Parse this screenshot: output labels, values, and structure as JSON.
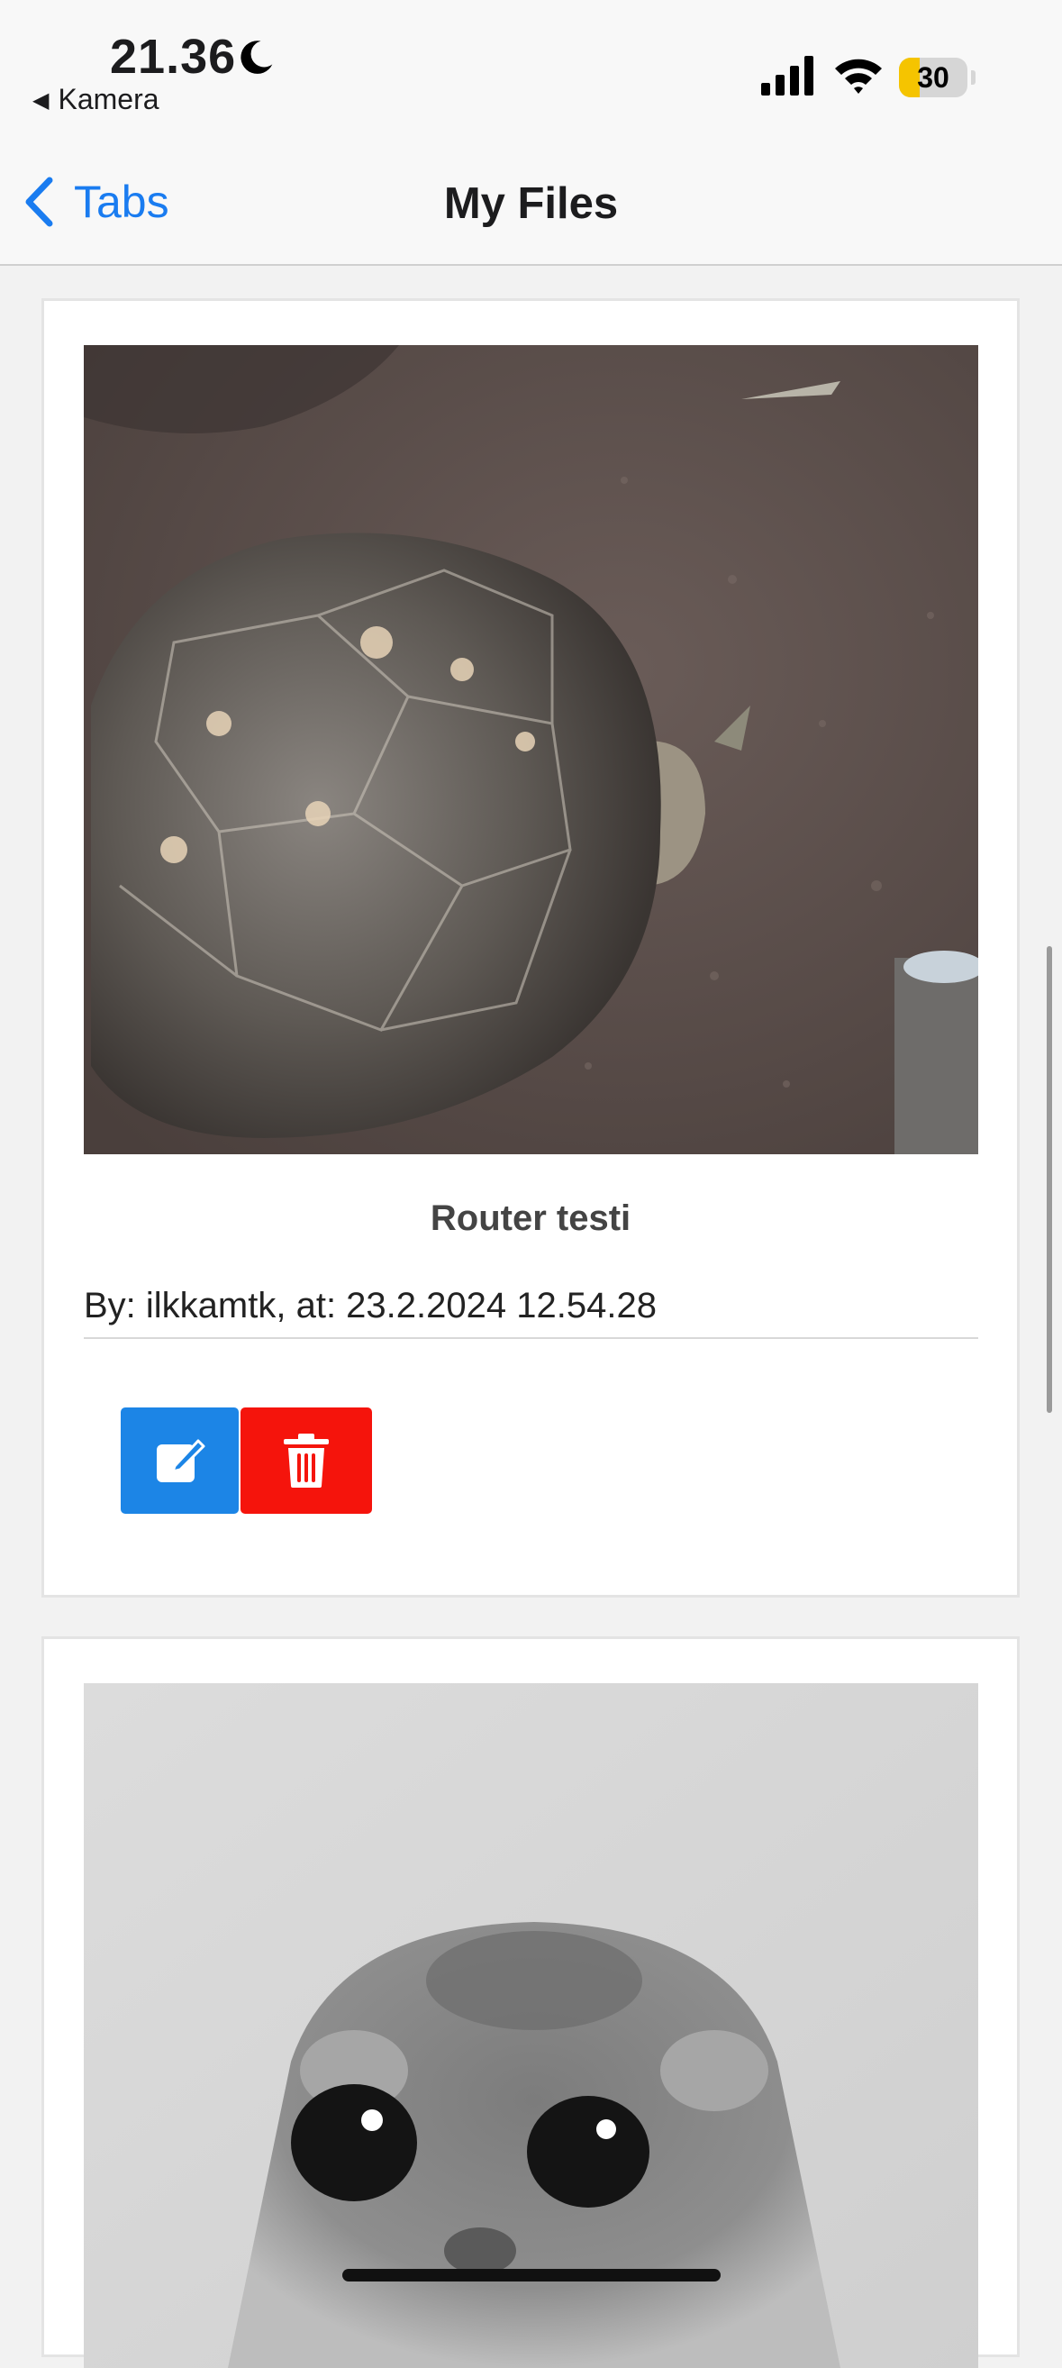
{
  "status_bar": {
    "time": "21.36",
    "back_app": "Kamera",
    "battery": "30"
  },
  "nav": {
    "back_label": "Tabs",
    "title": "My Files"
  },
  "files": [
    {
      "title": "Router testi",
      "meta": "By: ilkkamtk, at: 23.2.2024 12.54.28"
    }
  ],
  "icons": {
    "edit": "edit-icon",
    "delete": "trash-icon",
    "back": "chevron-left-icon",
    "moon": "moon-icon",
    "signal": "cellular-signal-icon",
    "wifi": "wifi-icon"
  },
  "colors": {
    "accent": "#1a7cf0",
    "edit_button": "#1c85e6",
    "delete_button": "#f5140c",
    "battery": "#f5c400"
  }
}
